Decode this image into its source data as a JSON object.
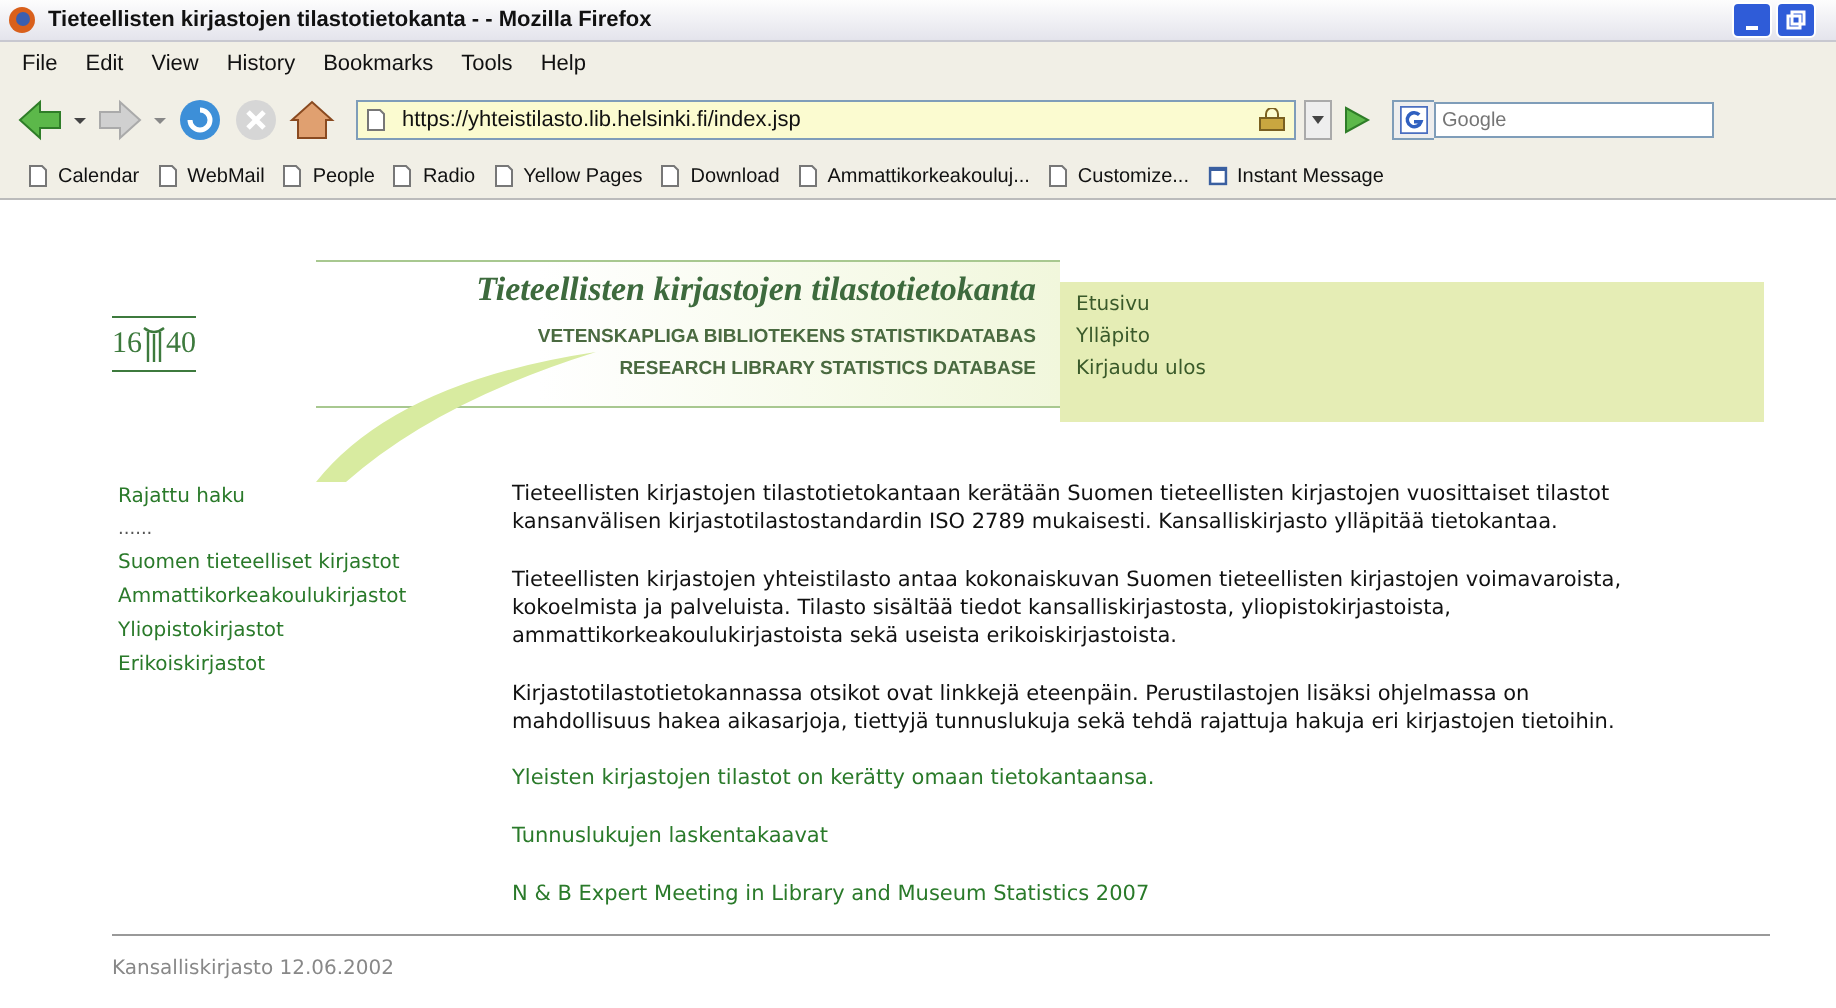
{
  "window": {
    "title": "Tieteellisten kirjastojen tilastotietokanta - - Mozilla Firefox"
  },
  "menu": [
    "File",
    "Edit",
    "View",
    "History",
    "Bookmarks",
    "Tools",
    "Help"
  ],
  "address_bar": {
    "value": "https://yhteistilasto.lib.helsinki.fi/index.jsp"
  },
  "search": {
    "placeholder": "Google"
  },
  "bookmarks": [
    {
      "label": "Calendar",
      "kind": "page"
    },
    {
      "label": "WebMail",
      "kind": "page"
    },
    {
      "label": "People",
      "kind": "page"
    },
    {
      "label": "Radio",
      "kind": "page"
    },
    {
      "label": "Yellow Pages",
      "kind": "page"
    },
    {
      "label": "Download",
      "kind": "page"
    },
    {
      "label": "Ammattikorkeakouluj...",
      "kind": "page"
    },
    {
      "label": "Customize...",
      "kind": "page"
    },
    {
      "label": "Instant Message",
      "kind": "app"
    }
  ],
  "header": {
    "logo": [
      "16",
      "40"
    ],
    "title": "Tieteellisten kirjastojen tilastotietokanta",
    "subtitle_sv": "VETENSKAPLIGA BIBLIOTEKENS STATISTIKDATABAS",
    "subtitle_en": "RESEARCH LIBRARY STATISTICS DATABASE",
    "nav": [
      "Etusivu",
      "Ylläpito",
      "Kirjaudu ulos"
    ]
  },
  "sidebar": [
    {
      "label": "Rajattu haku",
      "kind": "link"
    },
    {
      "label": "......",
      "kind": "separator"
    },
    {
      "label": "Suomen tieteelliset kirjastot",
      "kind": "link"
    },
    {
      "label": "Ammattikorkeakoulukirjastot",
      "kind": "link"
    },
    {
      "label": "Yliopistokirjastot",
      "kind": "link"
    },
    {
      "label": "Erikoiskirjastot",
      "kind": "link"
    }
  ],
  "content": [
    {
      "kind": "text",
      "text": "Tieteellisten kirjastojen tilastotietokantaan kerätään Suomen tieteellisten kirjastojen vuosittaiset tilastot kansanvälisen kirjastotilastostandardin ISO 2789 mukaisesti. Kansalliskirjasto ylläpitää tietokantaa."
    },
    {
      "kind": "text",
      "text": "Tieteellisten kirjastojen yhteistilasto antaa kokonaiskuvan Suomen tieteellisten kirjastojen voimavaroista, kokoelmista ja palveluista. Tilasto sisältää tiedot kansalliskirjastosta, yliopistokirjastoista, ammattikorkeakoulukirjastoista sekä useista erikoiskirjastoista."
    },
    {
      "kind": "text",
      "text": "Kirjastotilastotietokannassa otsikot ovat linkkejä eteenpäin. Perustilastojen lisäksi ohjelmassa on mahdollisuus hakea aikasarjoja, tiettyjä tunnuslukuja sekä tehdä rajattuja hakuja eri kirjastojen tietoihin."
    },
    {
      "kind": "link",
      "text": "Yleisten kirjastojen tilastot on kerätty omaan tietokantaansa."
    },
    {
      "kind": "link",
      "text": "Tunnuslukujen laskentakaavat"
    },
    {
      "kind": "link",
      "text": "N & B Expert Meeting in Library and Museum Statistics 2007"
    }
  ],
  "footer": "Kansalliskirjasto 12.06.2002"
}
